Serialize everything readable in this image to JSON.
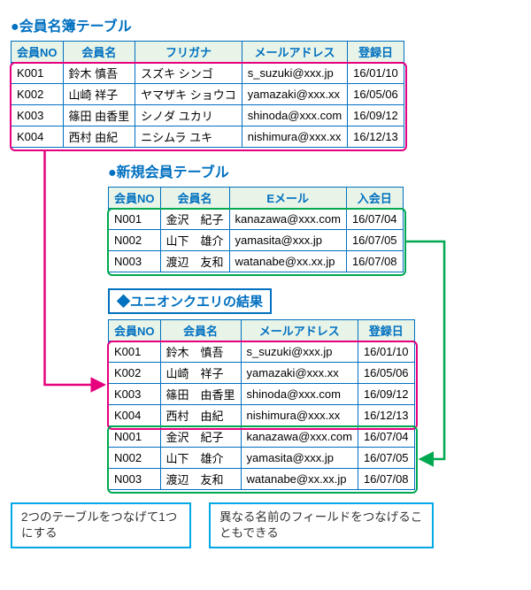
{
  "titles": {
    "table1": "●会員名簿テーブル",
    "table2": "●新規会員テーブル",
    "union": "◆ユニオンクエリの結果"
  },
  "table1": {
    "headers": [
      "会員NO",
      "会員名",
      "フリガナ",
      "メールアドレス",
      "登録日"
    ],
    "rows": [
      [
        "K001",
        "鈴木 慎吾",
        "スズキ シンゴ",
        "s_suzuki@xxx.jp",
        "16/01/10"
      ],
      [
        "K002",
        "山崎 祥子",
        "ヤマザキ ショウコ",
        "yamazaki@xxx.xx",
        "16/05/06"
      ],
      [
        "K003",
        "篠田 由香里",
        "シノダ ユカリ",
        "shinoda@xxx.com",
        "16/09/12"
      ],
      [
        "K004",
        "西村 由紀",
        "ニシムラ ユキ",
        "nishimura@xxx.xx",
        "16/12/13"
      ]
    ]
  },
  "table2": {
    "headers": [
      "会員NO",
      "会員名",
      "Eメール",
      "入会日"
    ],
    "rows": [
      [
        "N001",
        "金沢　紀子",
        "kanazawa@xxx.com",
        "16/07/04"
      ],
      [
        "N002",
        "山下　雄介",
        "yamasita@xxx.jp",
        "16/07/05"
      ],
      [
        "N003",
        "渡辺　友和",
        "watanabe@xx.xx.jp",
        "16/07/08"
      ]
    ]
  },
  "table3": {
    "headers": [
      "会員NO",
      "会員名",
      "メールアドレス",
      "登録日"
    ],
    "rows": [
      [
        "K001",
        "鈴木　慎吾",
        "s_suzuki@xxx.jp",
        "16/01/10"
      ],
      [
        "K002",
        "山崎　祥子",
        "yamazaki@xxx.xx",
        "16/05/06"
      ],
      [
        "K003",
        "篠田　由香里",
        "shinoda@xxx.com",
        "16/09/12"
      ],
      [
        "K004",
        "西村　由紀",
        "nishimura@xxx.xx",
        "16/12/13"
      ],
      [
        "N001",
        "金沢　紀子",
        "kanazawa@xxx.com",
        "16/07/04"
      ],
      [
        "N002",
        "山下　雄介",
        "yamasita@xxx.jp",
        "16/07/05"
      ],
      [
        "N003",
        "渡辺　友和",
        "watanabe@xx.xx.jp",
        "16/07/08"
      ]
    ]
  },
  "callouts": {
    "left": "2つのテーブルをつなげて1つにする",
    "right": "異なる名前のフィールドをつなげることもできる"
  },
  "colors": {
    "blue": "#0070c0",
    "pink": "#e6007e",
    "green": "#00a850",
    "cyan": "#00a8e8"
  }
}
